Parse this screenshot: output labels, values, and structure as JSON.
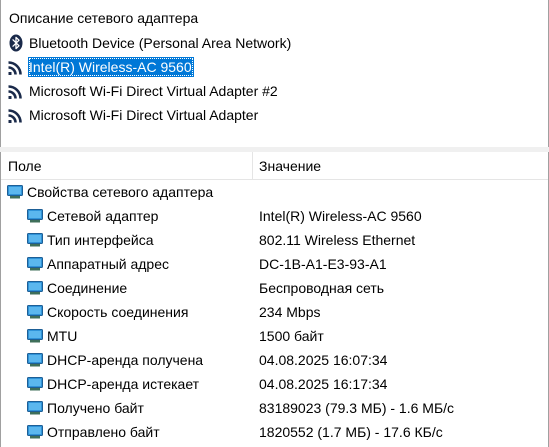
{
  "adapters_panel": {
    "header": "Описание сетевого адаптера",
    "items": [
      {
        "label": "Bluetooth Device (Personal Area Network)",
        "icon": "bluetooth-icon",
        "selected": false
      },
      {
        "label": "Intel(R) Wireless-AC 9560",
        "icon": "wifi-icon",
        "selected": true
      },
      {
        "label": "Microsoft Wi-Fi Direct Virtual Adapter #2",
        "icon": "wifi-icon",
        "selected": false
      },
      {
        "label": "Microsoft Wi-Fi Direct Virtual Adapter",
        "icon": "wifi-icon",
        "selected": false
      }
    ]
  },
  "properties_panel": {
    "columns": {
      "field": "Поле",
      "value": "Значение"
    },
    "group": {
      "label": "Свойства сетевого адаптера",
      "icon": "network-adapter-icon"
    },
    "rows": [
      {
        "field": "Сетевой адаптер",
        "value": "Intel(R) Wireless-AC 9560",
        "icon": "network-adapter-icon"
      },
      {
        "field": "Тип интерфейса",
        "value": "802.11 Wireless Ethernet",
        "icon": "network-adapter-icon"
      },
      {
        "field": "Аппаратный адрес",
        "value": "DC-1B-A1-E3-93-A1",
        "icon": "network-adapter-icon"
      },
      {
        "field": "Соединение",
        "value": "Беспроводная сеть",
        "icon": "network-adapter-icon"
      },
      {
        "field": "Скорость соединения",
        "value": "234 Mbps",
        "icon": "network-adapter-icon"
      },
      {
        "field": "MTU",
        "value": "1500 байт",
        "icon": "network-adapter-icon"
      },
      {
        "field": "DHCP-аренда получена",
        "value": "04.08.2025 16:07:34",
        "icon": "network-adapter-icon"
      },
      {
        "field": "DHCP-аренда истекает",
        "value": "04.08.2025 16:17:34",
        "icon": "network-adapter-icon"
      },
      {
        "field": "Получено байт",
        "value": "83189023 (79.3 МБ) - 1.6 МБ/с",
        "icon": "network-adapter-icon"
      },
      {
        "field": "Отправлено байт",
        "value": "1820552 (1.7 МБ) - 17.6 КБ/с",
        "icon": "network-adapter-icon"
      }
    ]
  },
  "colors": {
    "selection": "#0078d7",
    "border": "#a0a0a0",
    "wifi_icon": "#1a2a4a",
    "adapter_icon_screen": "#2f93d8"
  }
}
